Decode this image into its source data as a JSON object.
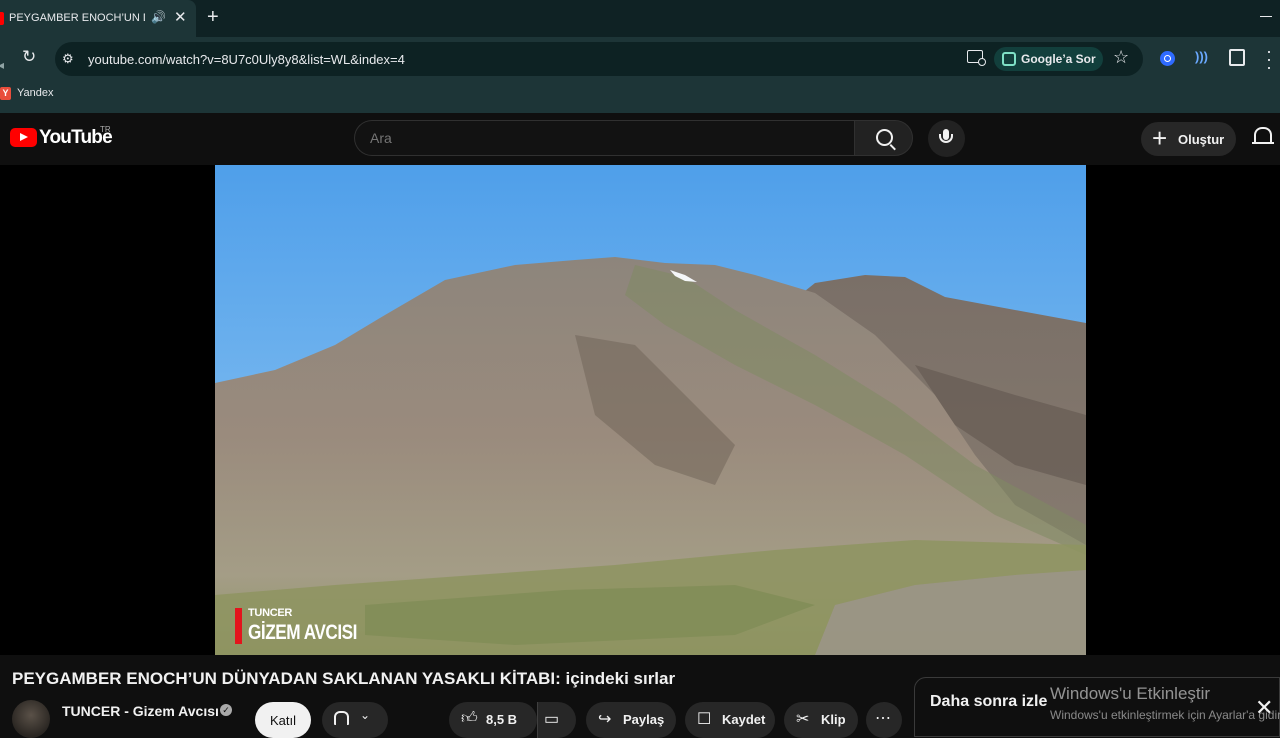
{
  "browser": {
    "tab_title": "PEYGAMBER ENOCH’UN DÜ",
    "url": "youtube.com/watch?v=8U7c0Uly8y8&list=WL&index=4",
    "lens_label": "Google’a Sor",
    "bookmarks": [
      {
        "label": "Yandex",
        "icon": "Y"
      }
    ]
  },
  "youtube": {
    "logo_text": "YouTube",
    "country_code": "TR",
    "search_placeholder": "Ara",
    "create_label": "Oluştur"
  },
  "video": {
    "watermark_small": "TUNCER",
    "watermark_main": "GİZEM AVCISI",
    "title": "PEYGAMBER ENOCH’UN DÜNYADAN SAKLANAN YASAKLI KİTABI: içindeki sırlar"
  },
  "channel": {
    "name": "TUNCER - Gizem Avcısı",
    "join_label": "Katıl"
  },
  "actions": {
    "like_count": "8,5 B",
    "share_label": "Paylaş",
    "save_label": "Kaydet",
    "clip_label": "Klip"
  },
  "watch_later": {
    "label": "Daha sonra izle"
  },
  "windows_activation": {
    "title": "Windows'u Etkinleştir",
    "subtitle": "Windows'u etkinleştirmek için Ayarlar'a gidin."
  },
  "colors": {
    "youtube_red": "#ff0000",
    "chrome_frame": "#1d3537",
    "page_bg": "#0f0f0f"
  }
}
